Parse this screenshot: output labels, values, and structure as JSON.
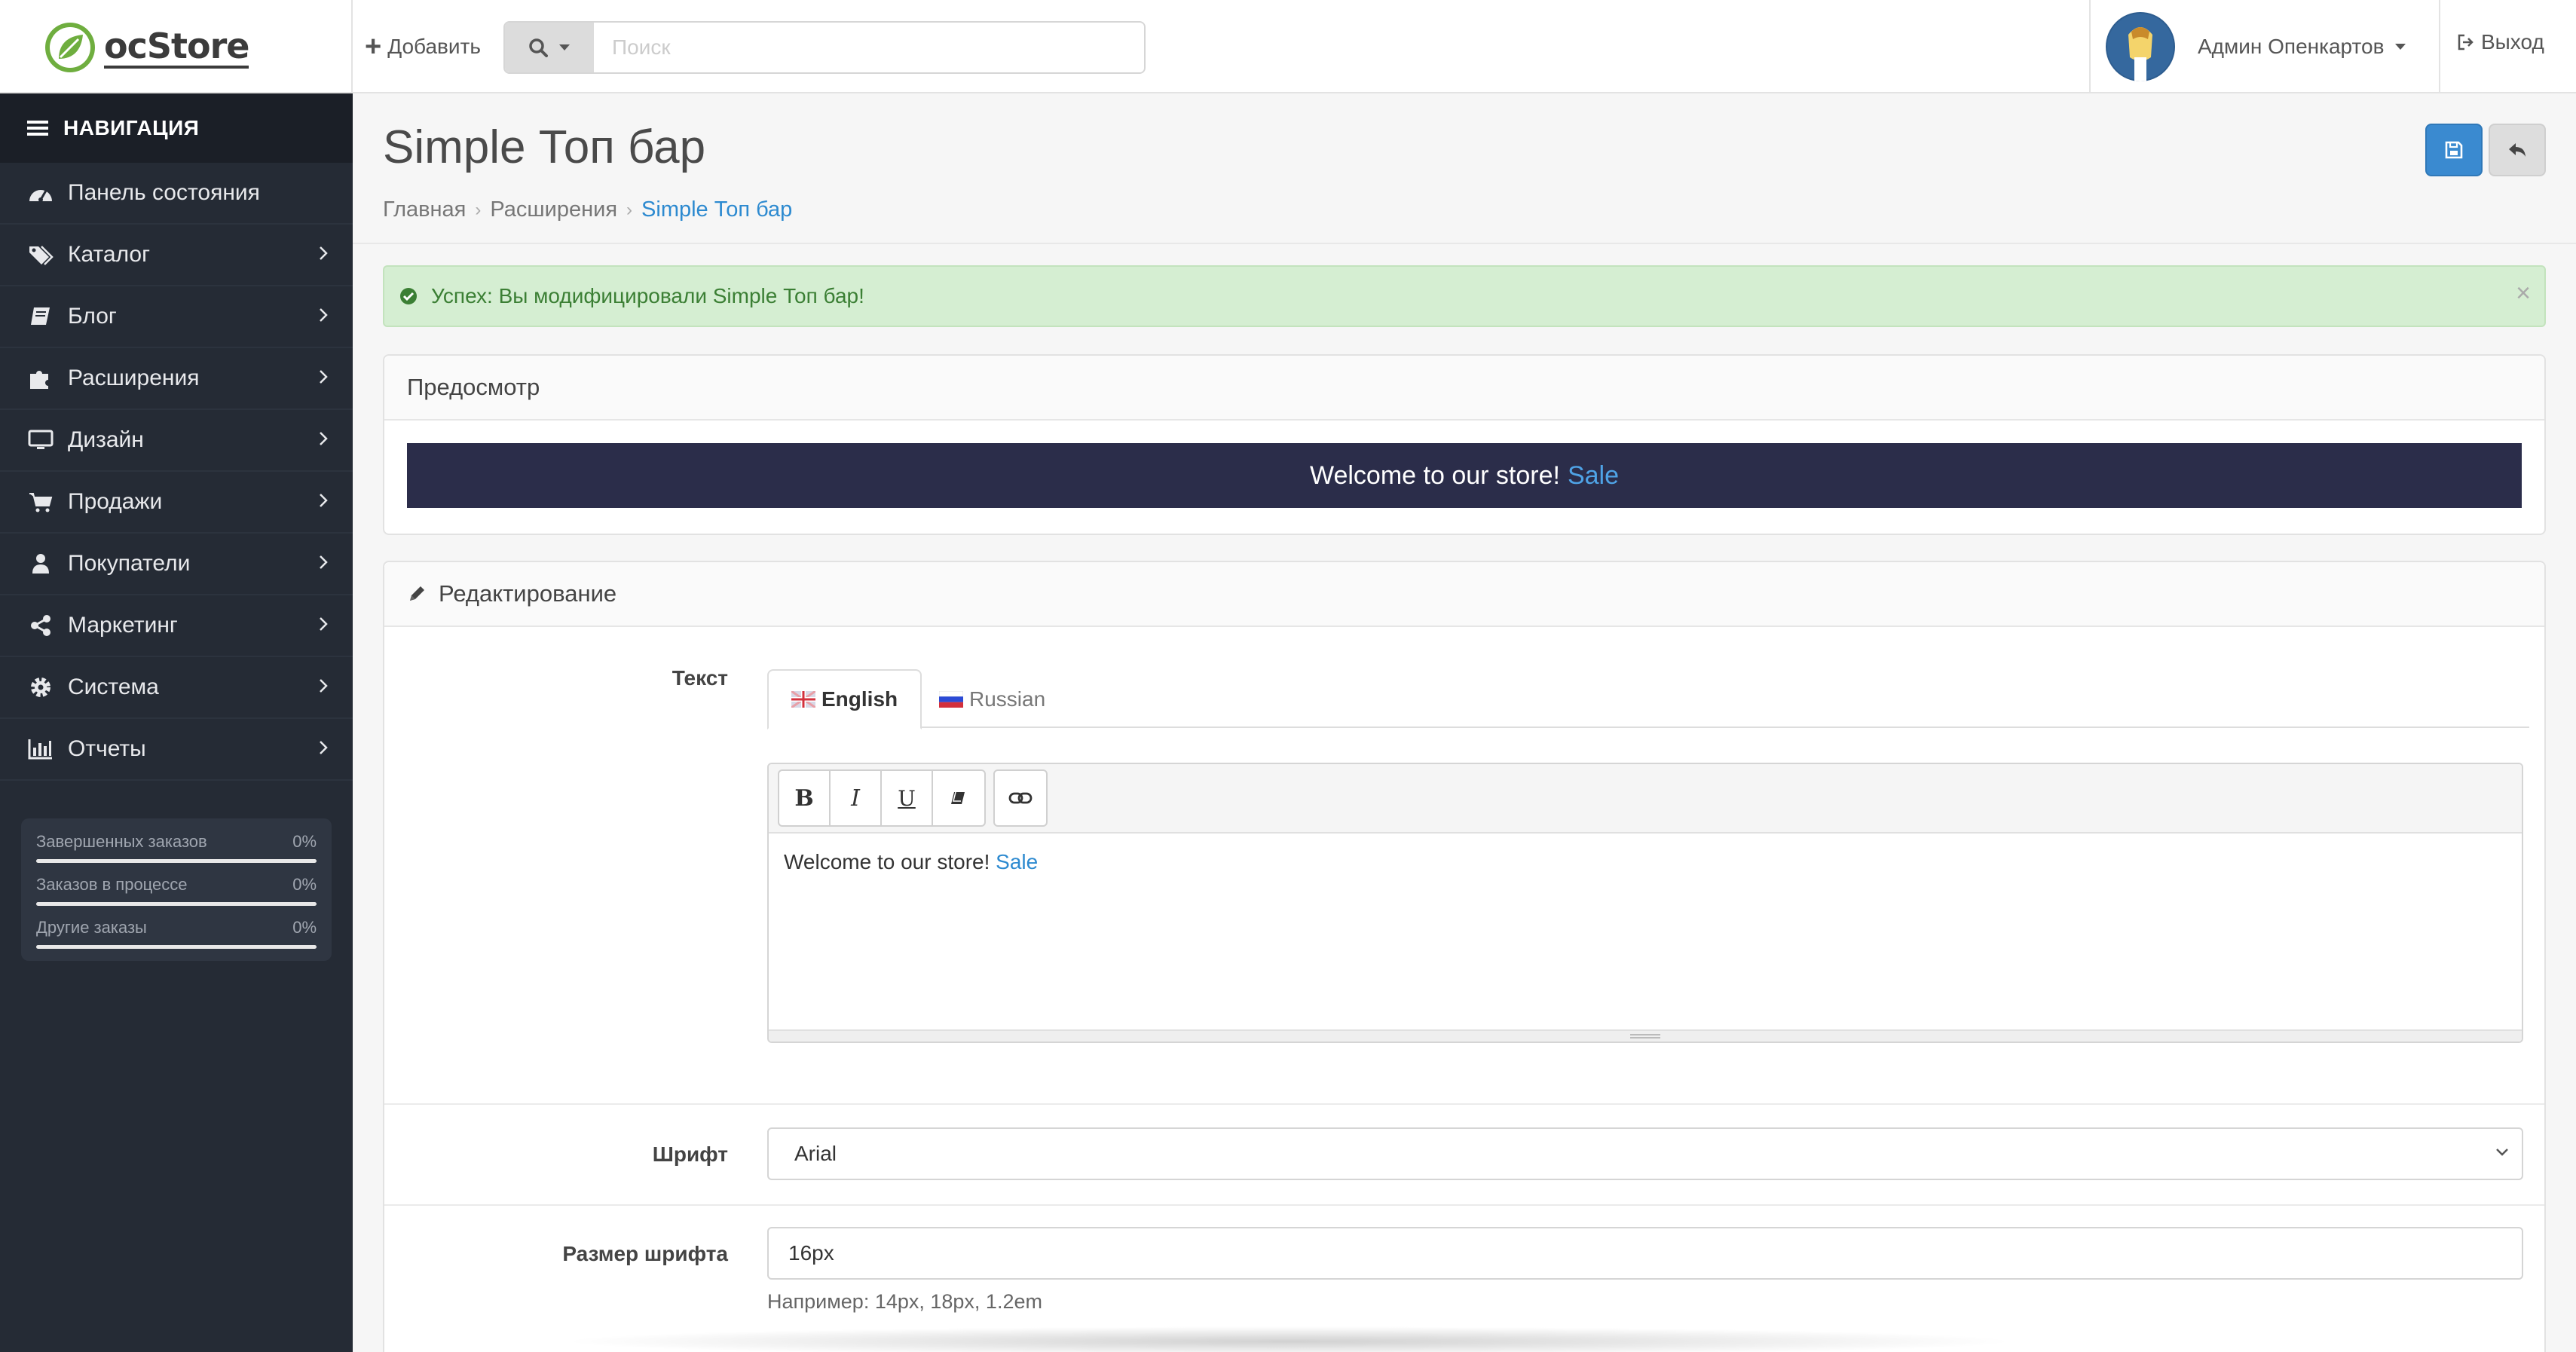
{
  "header": {
    "logo_text": "ocStore",
    "add_label": "Добавить",
    "search_placeholder": "Поиск",
    "user_name": "Админ Опенкартов",
    "logout_label": "Выход"
  },
  "sidebar": {
    "title": "НАВИГАЦИЯ",
    "items": [
      {
        "label": "Панель состояния",
        "icon": "dashboard-icon",
        "has_arrow": false
      },
      {
        "label": "Каталог",
        "icon": "tags-icon",
        "has_arrow": true
      },
      {
        "label": "Блог",
        "icon": "book-icon",
        "has_arrow": true
      },
      {
        "label": "Расширения",
        "icon": "puzzle-icon",
        "has_arrow": true
      },
      {
        "label": "Дизайн",
        "icon": "monitor-icon",
        "has_arrow": true
      },
      {
        "label": "Продажи",
        "icon": "cart-icon",
        "has_arrow": true
      },
      {
        "label": "Покупатели",
        "icon": "user-icon",
        "has_arrow": true
      },
      {
        "label": "Маркетинг",
        "icon": "share-icon",
        "has_arrow": true
      },
      {
        "label": "Система",
        "icon": "gear-icon",
        "has_arrow": true
      },
      {
        "label": "Отчеты",
        "icon": "bar-chart-icon",
        "has_arrow": true
      }
    ],
    "stats": [
      {
        "label": "Завершенных заказов",
        "value": "0%",
        "fill": 0
      },
      {
        "label": "Заказов в процессе",
        "value": "0%",
        "fill": 0
      },
      {
        "label": "Другие заказы",
        "value": "0%",
        "fill": 0
      }
    ]
  },
  "page": {
    "title": "Simple Топ бар",
    "breadcrumbs": [
      "Главная",
      "Расширения",
      "Simple Топ бар"
    ],
    "alert": "Успех: Вы модифицировали Simple Топ бар!",
    "alert_close": "×"
  },
  "preview": {
    "heading": "Предосмотр",
    "text": "Welcome to our store!",
    "link": "Sale",
    "bg_color": "#2b2d4a",
    "link_color": "#4fa3e6"
  },
  "edit": {
    "heading": "Редактирование",
    "text_label": "Текст",
    "tabs": [
      {
        "label": "English",
        "active": true
      },
      {
        "label": "Russian",
        "active": false
      }
    ],
    "editor_text": "Welcome to our store!",
    "editor_link": "Sale",
    "font_label": "Шрифт",
    "font_value": "Arial",
    "size_label": "Размер шрифта",
    "size_value": "16px",
    "size_help": "Например: 14px, 18px, 1.2em"
  },
  "colors": {
    "accent": "#3a8ad0",
    "sidebar_bg": "#252b35",
    "success_bg": "#d5eed2"
  }
}
